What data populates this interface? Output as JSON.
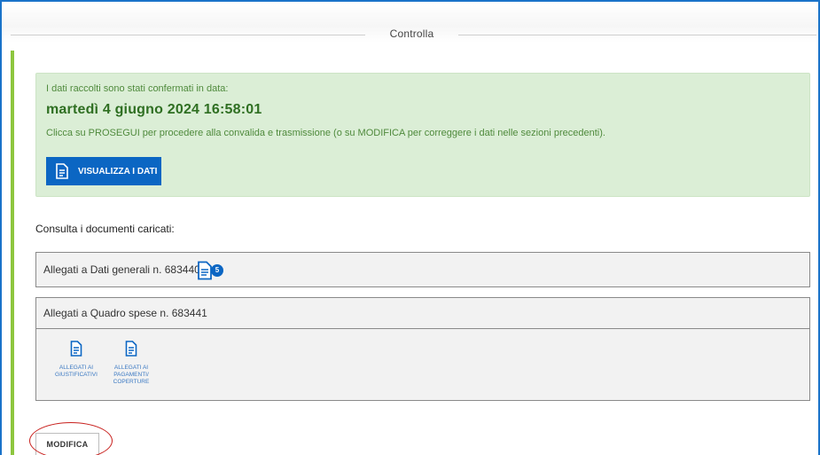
{
  "header": {
    "title": "Controlla"
  },
  "confirmation": {
    "intro": "I dati raccolti sono stati confermati in data:",
    "date": "martedì 4 giugno 2024 16:58:01",
    "instructions": "Clicca su PROSEGUI per procedere alla convalida e trasmissione (o su MODIFICA per correggere i dati nelle sezioni precedenti).",
    "view_button": "VISUALIZZA I DATI"
  },
  "documents": {
    "label": "Consulta i documenti caricati:",
    "general": {
      "text": "Allegati a Dati generali n. 683440",
      "badge": "5"
    },
    "expenses": {
      "text": "Allegati a Quadro spese n. 683441",
      "links": [
        {
          "lines": [
            "ALLEGATI AI",
            "GIUSTIFICATIVI"
          ]
        },
        {
          "lines": [
            "ALLEGATI AI",
            "PAGAMENTI/",
            "COPERTURE"
          ]
        }
      ]
    }
  },
  "actions": {
    "modify_button": "MODIFICA"
  },
  "colors": {
    "primary": "#0b66c3",
    "success_bg": "#dbeed6",
    "success_text": "#2f6f22",
    "accent_bar": "#8dc63f",
    "highlight": "#c8201d"
  },
  "icons": {
    "view": "document-icon",
    "attachments": "document-icon"
  }
}
